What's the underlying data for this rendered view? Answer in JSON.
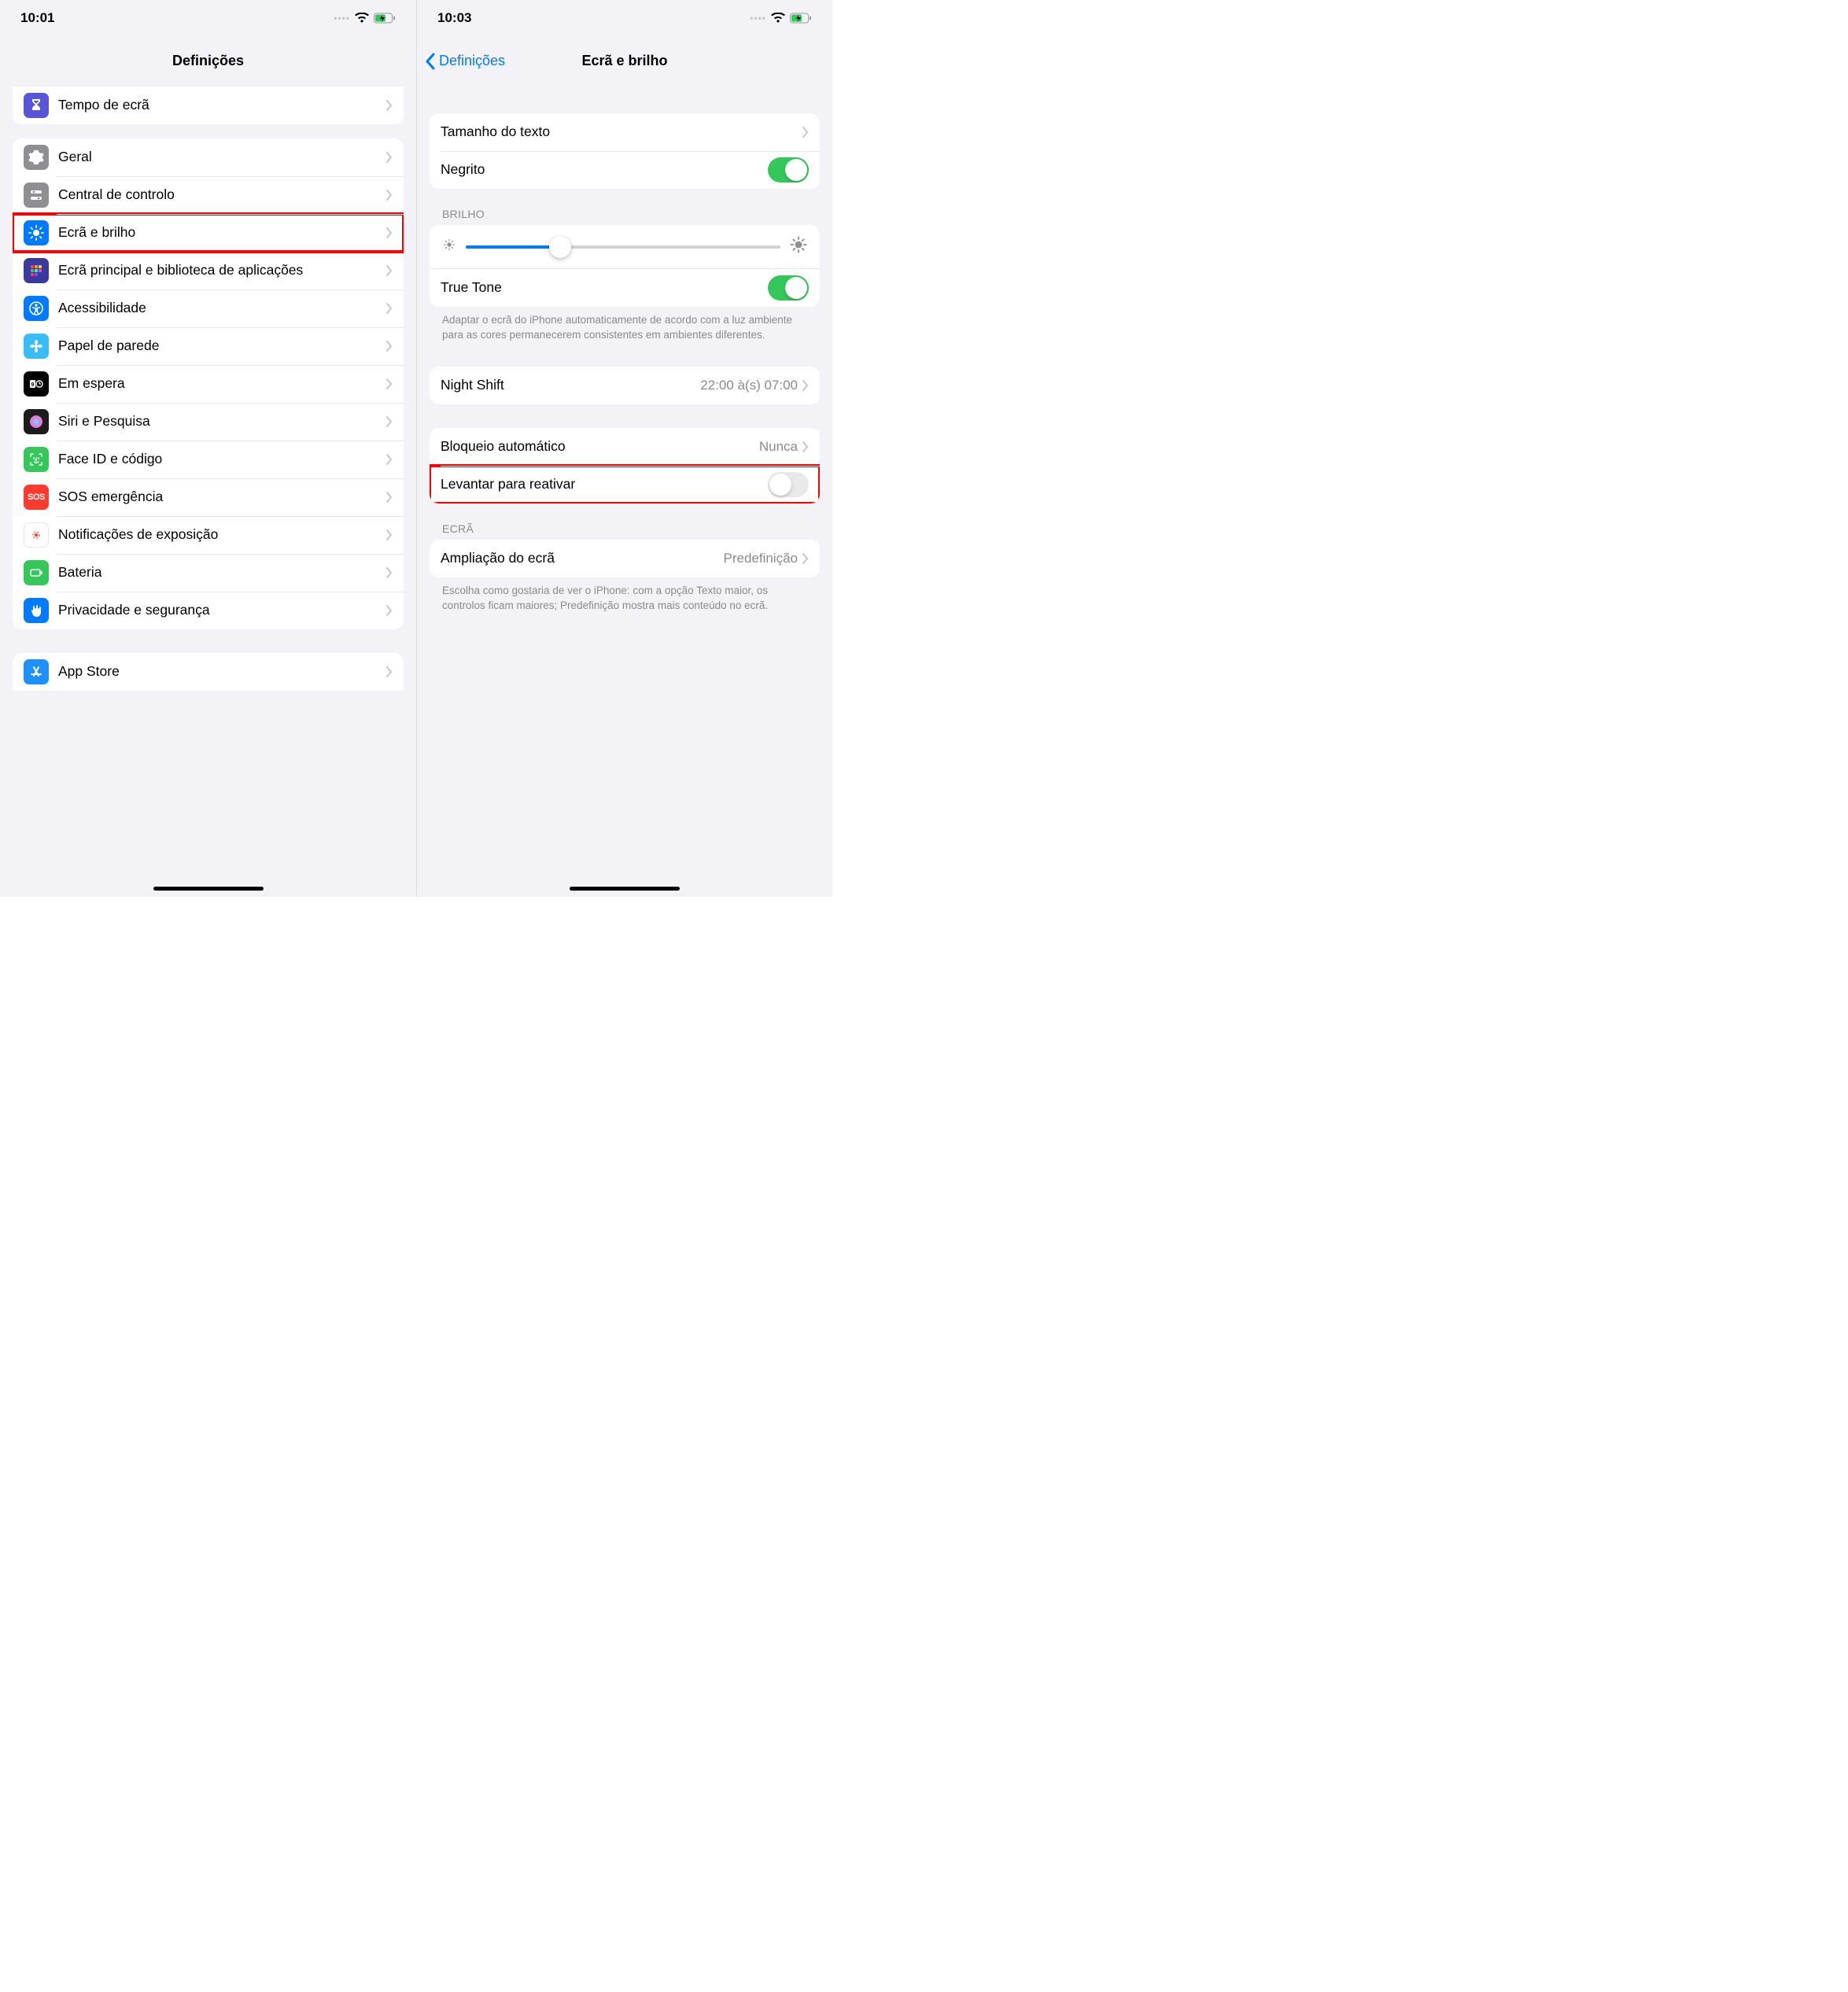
{
  "left": {
    "time": "10:01",
    "nav_title": "Definições",
    "group_top": [
      {
        "key": "screen-time",
        "label": "Tempo de ecrã"
      }
    ],
    "group_main": [
      {
        "key": "general",
        "label": "Geral"
      },
      {
        "key": "control-center",
        "label": "Central de controlo"
      },
      {
        "key": "display",
        "label": "Ecrã e brilho",
        "highlight": true
      },
      {
        "key": "home-screen",
        "label": "Ecrã principal e biblioteca de aplicações"
      },
      {
        "key": "accessibility",
        "label": "Acessibilidade"
      },
      {
        "key": "wallpaper",
        "label": "Papel de parede"
      },
      {
        "key": "standby",
        "label": "Em espera"
      },
      {
        "key": "siri",
        "label": "Siri e Pesquisa"
      },
      {
        "key": "faceid",
        "label": "Face ID e código"
      },
      {
        "key": "sos",
        "label": "SOS emergência"
      },
      {
        "key": "exposure",
        "label": "Notificações de exposição"
      },
      {
        "key": "battery",
        "label": "Bateria"
      },
      {
        "key": "privacy",
        "label": "Privacidade e segurança"
      }
    ],
    "group_bottom": [
      {
        "key": "appstore",
        "label": "App Store"
      }
    ]
  },
  "right": {
    "time": "10:03",
    "nav_back": "Definições",
    "nav_title": "Ecrã e brilho",
    "text_group": {
      "text_size": {
        "label": "Tamanho do texto"
      },
      "bold": {
        "label": "Negrito",
        "on": true
      }
    },
    "brightness_header": "BRILHO",
    "brightness_value_pct": 30,
    "true_tone": {
      "label": "True Tone",
      "on": true
    },
    "true_tone_footer": "Adaptar o ecrã do iPhone automaticamente de acordo com a luz ambiente para as cores permanecerem consistentes em ambientes diferentes.",
    "night_shift": {
      "label": "Night Shift",
      "detail": "22:00 à(s) 07:00"
    },
    "auto_lock": {
      "label": "Bloqueio automático",
      "detail": "Nunca"
    },
    "raise_wake": {
      "label": "Levantar para reativar",
      "on": false,
      "highlight": true
    },
    "ecra_header": "ECRÃ",
    "display_zoom": {
      "label": "Ampliação do ecrã",
      "detail": "Predefinição"
    },
    "display_zoom_footer": "Escolha como gostaria de ver o iPhone: com a opção Texto maior, os controlos ficam maiores; Predefinição mostra mais conteúdo no ecrã."
  }
}
